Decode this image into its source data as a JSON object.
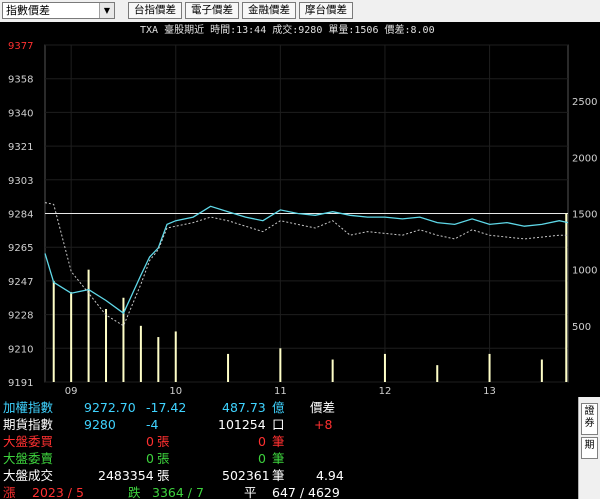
{
  "toolbar": {
    "selector_value": "指數價差",
    "tabs": [
      "台指價差",
      "電子價差",
      "金融價差",
      "摩台價差"
    ]
  },
  "chart_header": "TXA  臺股期近 時間:13:44 成交:9280 單量:1506 價差:8.00",
  "chart_data": {
    "type": "line",
    "x_tick_labels": [
      "09",
      "10",
      "11",
      "12",
      "13"
    ],
    "y_left_ticks": [
      "9377",
      "9358",
      "9340",
      "9321",
      "9303",
      "9284",
      "9265",
      "9247",
      "9228",
      "9210",
      "9191"
    ],
    "y_left_range": [
      9191,
      9377
    ],
    "y_right_ticks": [
      "2500",
      "2000",
      "1500",
      "1000",
      "500"
    ],
    "y_right_range": [
      0,
      3000
    ],
    "reference_level": 9284,
    "highlight_tick": "9377",
    "series": [
      {
        "color": "#5fd8e8",
        "x": [
          "08:45",
          "08:50",
          "09:00",
          "09:10",
          "09:20",
          "09:30",
          "09:40",
          "09:45",
          "09:50",
          "09:55",
          "10:00",
          "10:10",
          "10:20",
          "10:30",
          "10:40",
          "10:50",
          "11:00",
          "11:10",
          "11:20",
          "11:30",
          "11:40",
          "11:50",
          "12:00",
          "12:10",
          "12:20",
          "12:30",
          "12:40",
          "12:50",
          "13:00",
          "13:10",
          "13:20",
          "13:30",
          "13:40",
          "13:45"
        ],
        "values": [
          9262,
          9246,
          9240,
          9242,
          9236,
          9229,
          9250,
          9260,
          9265,
          9278,
          9280,
          9282,
          9288,
          9285,
          9282,
          9280,
          9286,
          9284,
          9283,
          9285,
          9283,
          9282,
          9282,
          9281,
          9282,
          9279,
          9278,
          9281,
          9278,
          9279,
          9277,
          9278,
          9280,
          9279
        ]
      },
      {
        "color": "#c8c8c8",
        "dashed": true,
        "x": [
          "08:45",
          "08:50",
          "09:00",
          "09:10",
          "09:20",
          "09:30",
          "09:40",
          "09:45",
          "09:50",
          "09:55",
          "10:00",
          "10:10",
          "10:20",
          "10:30",
          "10:40",
          "10:50",
          "11:00",
          "11:10",
          "11:20",
          "11:30",
          "11:40",
          "11:50",
          "12:00",
          "12:10",
          "12:20",
          "12:30",
          "12:40",
          "12:50",
          "13:00",
          "13:10",
          "13:20",
          "13:30",
          "13:40",
          "13:45"
        ],
        "values": [
          9290,
          9289,
          9252,
          9240,
          9228,
          9222,
          9245,
          9258,
          9264,
          9276,
          9277,
          9279,
          9282,
          9280,
          9277,
          9274,
          9280,
          9278,
          9276,
          9280,
          9272,
          9274,
          9273,
          9272,
          9275,
          9272,
          9270,
          9275,
          9272,
          9271,
          9270,
          9271,
          9272,
          9272
        ]
      },
      {
        "color": "#ffffc8",
        "type": "bar",
        "x": [
          "08:50",
          "09:00",
          "09:10",
          "09:20",
          "09:30",
          "09:40",
          "09:50",
          "10:00",
          "10:30",
          "11:00",
          "11:30",
          "12:00",
          "12:30",
          "13:00",
          "13:30",
          "13:44"
        ],
        "values": [
          900,
          800,
          1000,
          650,
          750,
          500,
          400,
          450,
          250,
          300,
          200,
          250,
          150,
          250,
          200,
          1500
        ]
      }
    ]
  },
  "panel": {
    "rows": [
      [
        "加權指數",
        "9272.70",
        "-17.42",
        "487.73",
        "億",
        "價差"
      ],
      [
        "期貨指數",
        "9280",
        "-4",
        "101254",
        "口",
        "+8"
      ],
      [
        "大盤委買",
        "0",
        "張",
        "0",
        "筆"
      ],
      [
        "大盤委賣",
        "0",
        "張",
        "0",
        "筆"
      ],
      [
        "大盤成交",
        "2483354",
        "張",
        "502361",
        "筆",
        "4.94"
      ],
      [
        "漲",
        "2023 / 5",
        "跌",
        "3364 / 7",
        "平",
        "647 / 4629"
      ]
    ],
    "side_tabs": [
      "證券",
      "期"
    ]
  },
  "colors": {
    "index_line": "#5fd8e8",
    "futures_line": "#c8c8c8",
    "volume_bars": "#ffffc8",
    "grid": "#1e1e1e",
    "axis_text": "#d0d0d0",
    "highlight": "#ff3030"
  }
}
